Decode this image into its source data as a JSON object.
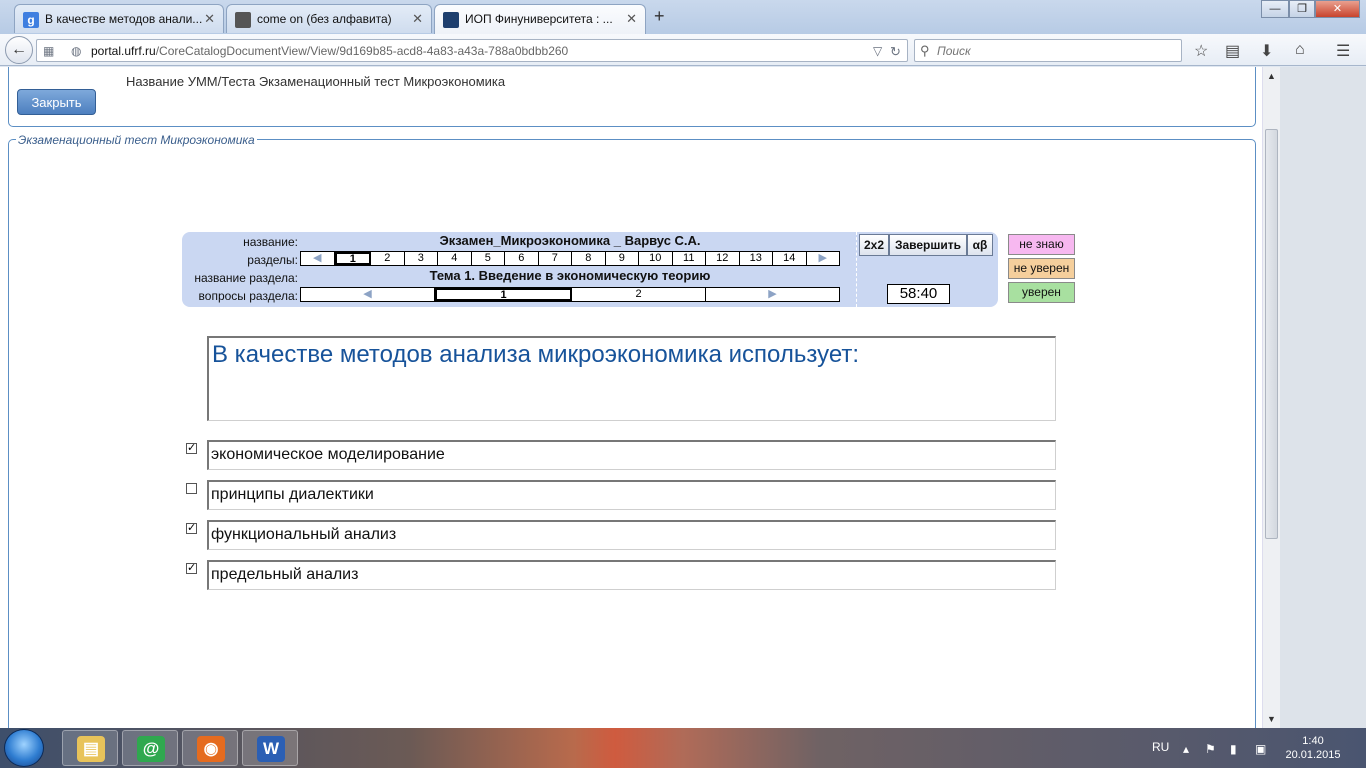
{
  "browser": {
    "tabs": [
      {
        "label": "В качестве методов анали...",
        "icon": "google-icon",
        "active": false
      },
      {
        "label": "come on (без алфавита)",
        "icon": "image-icon",
        "active": false
      },
      {
        "label": "ИОП Финуниверситета : ...",
        "icon": "graduation-cap-icon",
        "active": true
      }
    ],
    "close_glyph": "✕",
    "new_tab_glyph": "+",
    "window_controls": {
      "minimize": "—",
      "maximize": "❐",
      "close": "✕"
    },
    "url_host": "portal.ufrf.ru",
    "url_path": "/CoreCatalogDocumentView/View/9d169b85-acd8-4a83-a43a-788a0bdbb260",
    "url_prefix_icon": "grid-icon",
    "search_placeholder": "Поиск"
  },
  "page": {
    "umm_label": "Название УММ/Теста  Экзаменационный тест Микроэкономика",
    "close_button": "Закрыть",
    "legend": "Экзаменационный тест Микроэкономика"
  },
  "test_panel": {
    "labels": {
      "name": "название:",
      "sections": "разделы:",
      "section_name": "название раздела:",
      "section_questions": "вопросы раздела:"
    },
    "exam_name": "Экзамен_Микроэкономика _ Варвус С.А.",
    "section_numbers": [
      "1",
      "2",
      "3",
      "4",
      "5",
      "6",
      "7",
      "8",
      "9",
      "10",
      "11",
      "12",
      "13",
      "14"
    ],
    "selected_section": "1",
    "section_title": "Тема 1. Введение в экономическую теорию",
    "question_numbers": [
      "1",
      "2"
    ],
    "selected_question": "1",
    "arrow_left": "◀",
    "arrow_right": "▶",
    "btn_2x2": "2x2",
    "btn_finish": "Завершить",
    "btn_alpha": "αβ",
    "timer": "58:40"
  },
  "confidence": {
    "dont_know": "не знаю",
    "not_sure": "не уверен",
    "sure": "уверен",
    "colors": {
      "dont_know": "#f7b8f0",
      "not_sure": "#f5cf9c",
      "sure": "#a8e0a0"
    }
  },
  "question": {
    "text": "В качестве методов анализа микроэкономика использует:",
    "check_glyph": "✓",
    "answers": [
      {
        "text": "экономическое моделирование",
        "checked": true
      },
      {
        "text": "принципы диалектики",
        "checked": false
      },
      {
        "text": "функциональный анализ",
        "checked": true
      },
      {
        "text": "предельный анализ",
        "checked": true
      }
    ]
  },
  "taskbar": {
    "apps": [
      {
        "name": "explorer",
        "icon": "folder-icon",
        "glyph": "▤",
        "color": "#e8c35a"
      },
      {
        "name": "mail-agent",
        "icon": "at-icon",
        "glyph": "@",
        "color": "#2fa84f"
      },
      {
        "name": "firefox",
        "icon": "firefox-icon",
        "glyph": "◉",
        "color": "#e56b1f"
      },
      {
        "name": "word",
        "icon": "word-icon",
        "glyph": "W",
        "color": "#2b5fb4"
      }
    ],
    "language": "RU",
    "time": "1:40",
    "date": "20.01.2015"
  }
}
